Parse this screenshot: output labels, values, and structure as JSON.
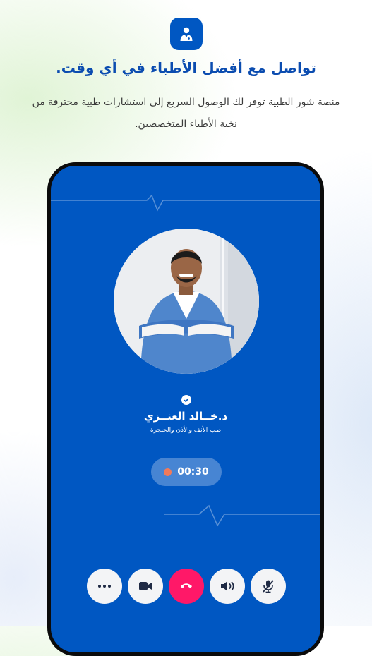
{
  "header": {
    "icon": "doctor-icon",
    "headline": "تواصل مع أفضل الأطباء في أي وقت.",
    "description": "منصة شور الطبية توفر لك الوصول السريع إلى استشارات طبية محترفة من نخبة الأطباء المتخصصين."
  },
  "call": {
    "doctor_name": "د.خــالد العنــزي",
    "specialty": "طب الأنف والأذن والحنجرة",
    "timer": "00:30",
    "verified_icon": "verified-check-icon"
  },
  "controls": [
    {
      "name": "more-options-button",
      "icon": "more-dots-icon"
    },
    {
      "name": "video-toggle-button",
      "icon": "video-camera-icon"
    },
    {
      "name": "end-call-button",
      "icon": "phone-hangup-icon"
    },
    {
      "name": "speaker-button",
      "icon": "speaker-icon"
    },
    {
      "name": "mute-mic-button",
      "icon": "mic-off-icon"
    }
  ],
  "colors": {
    "brand_blue": "#0057c2",
    "headline_blue": "#0b4cb0",
    "end_call_red": "#ff1868",
    "recording_dot": "#f07a5a"
  }
}
